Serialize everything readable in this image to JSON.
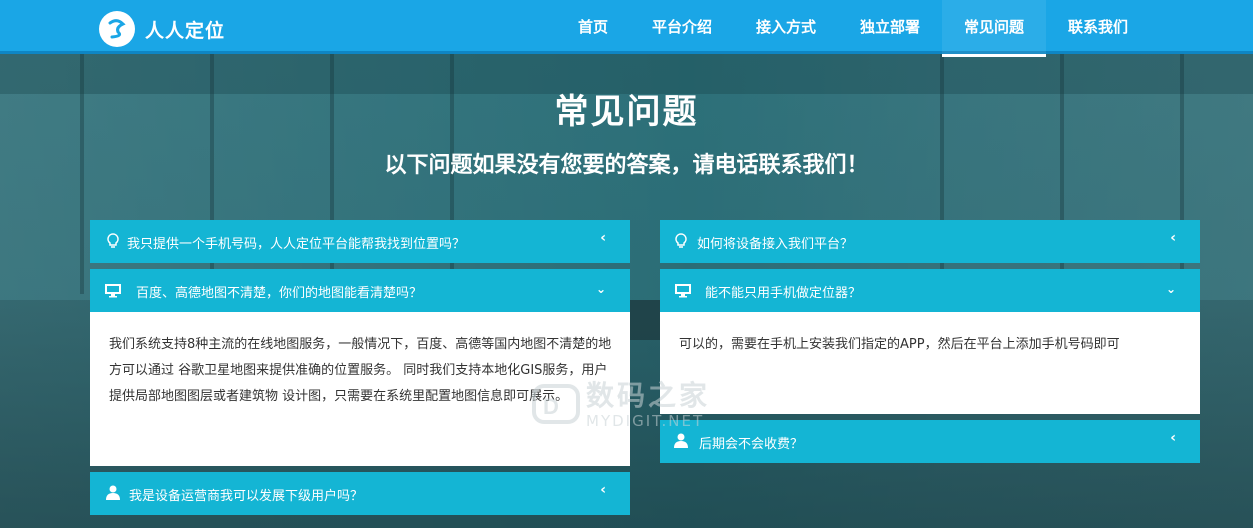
{
  "header": {
    "brand": "人人定位",
    "nav": [
      {
        "label": "首页"
      },
      {
        "label": "平台介绍"
      },
      {
        "label": "接入方式"
      },
      {
        "label": "独立部署"
      },
      {
        "label": "常见问题"
      },
      {
        "label": "联系我们"
      }
    ],
    "active_nav": "常见问题"
  },
  "hero": {
    "title": "常见问题",
    "subtitle": "以下问题如果没有您要的答案，请电话联系我们！"
  },
  "faq_left": [
    {
      "icon": "lightbulb-icon",
      "question": "我只提供一个手机号码，人人定位平台能帮我找到位置吗？",
      "expanded": false
    },
    {
      "icon": "monitor-icon",
      "question": "百度、高德地图不清楚，你们的地图能看清楚吗？",
      "expanded": true,
      "answer": "我们系统支持8种主流的在线地图服务，一般情况下，百度、高德等国内地图不清楚的地方可以通过 谷歌卫星地图来提供准确的位置服务。 同时我们支持本地化GIS服务，用户提供局部地图图层或者建筑物 设计图，只需要在系统里配置地图信息即可展示。"
    },
    {
      "icon": "user-icon",
      "question": "我是设备运营商我可以发展下级用户吗？",
      "expanded": false
    }
  ],
  "faq_right": [
    {
      "icon": "lightbulb-icon",
      "question": "如何将设备接入我们平台？",
      "expanded": false
    },
    {
      "icon": "monitor-icon",
      "question": "能不能只用手机做定位器？",
      "expanded": true,
      "answer": "可以的，需要在手机上安装我们指定的APP，然后在平台上添加手机号码即可"
    },
    {
      "icon": "user-icon",
      "question": "后期会不会收费？",
      "expanded": false
    }
  ],
  "watermark": {
    "title": "数码之家",
    "subtitle": "MYDIGIT.NET"
  },
  "colors": {
    "topbar": "#1aa6e6",
    "panel_header": "#14b5d4",
    "panel_body": "#ffffff"
  }
}
